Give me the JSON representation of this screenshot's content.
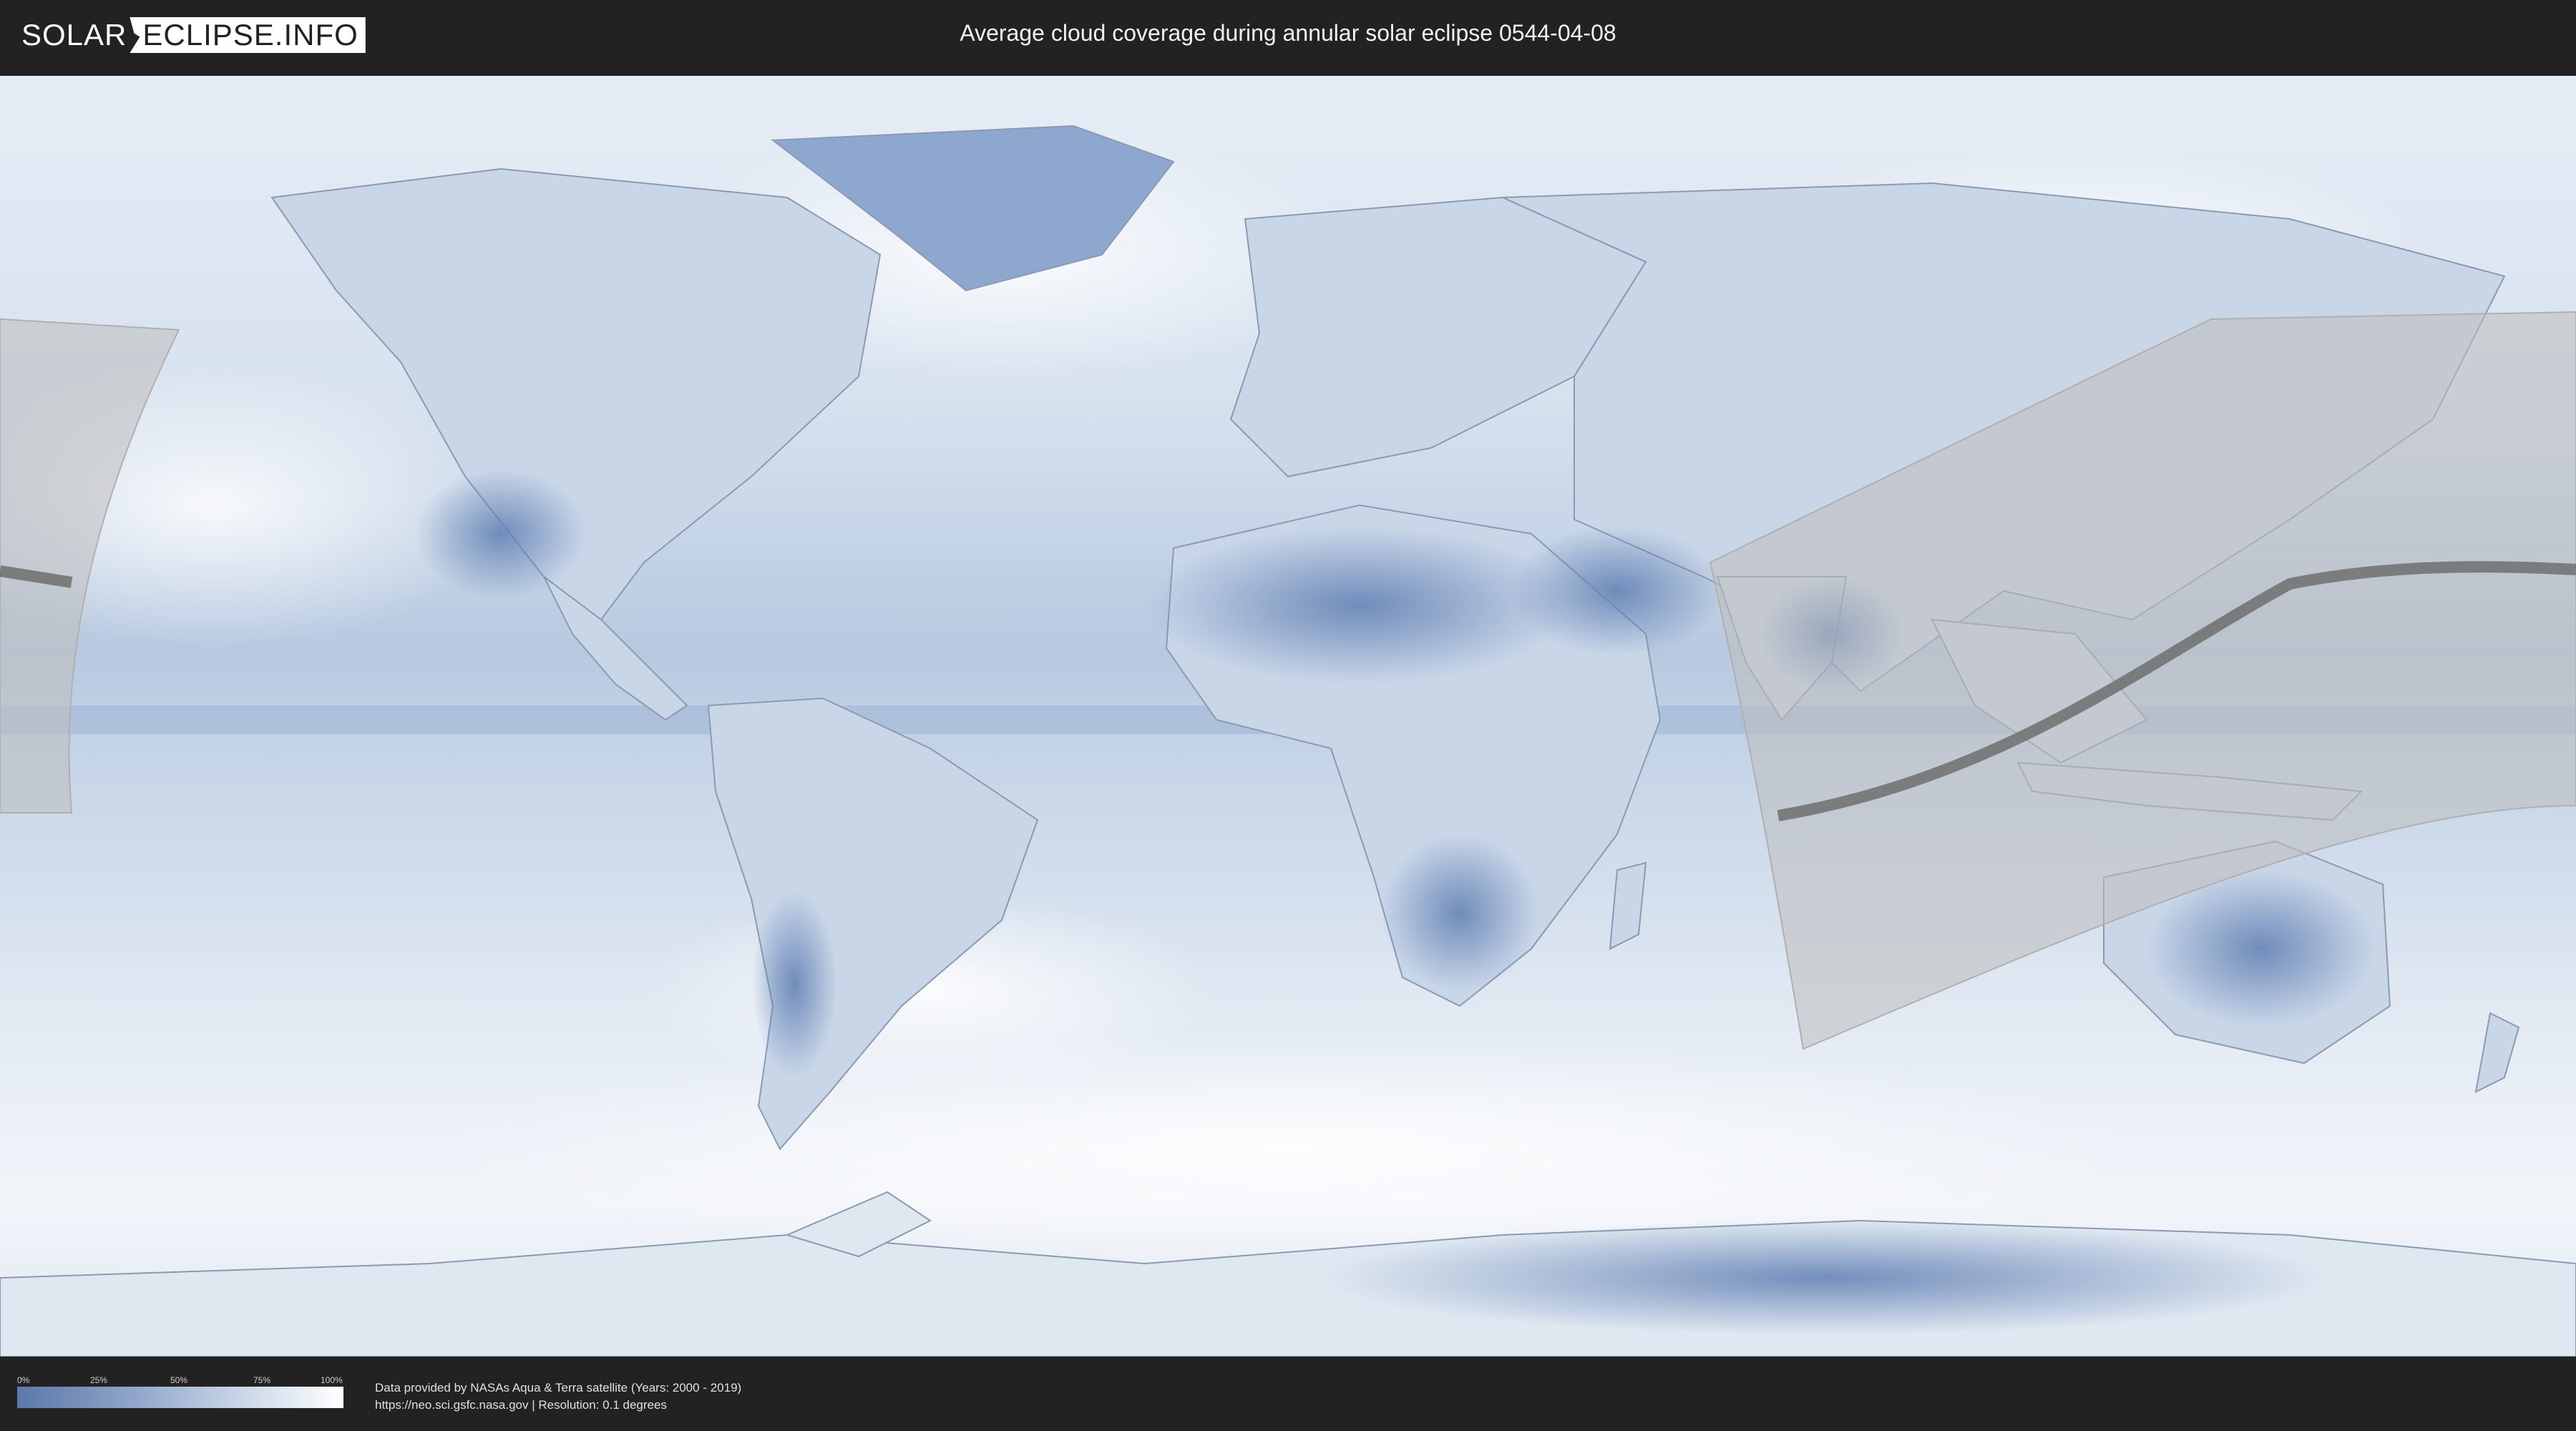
{
  "header": {
    "logo_part1": "SOLAR",
    "logo_part2": "ECLIPSE.INFO",
    "title": "Average cloud coverage during annular solar eclipse 0544-04-08"
  },
  "map": {
    "style": "cloud-coverage-world-map",
    "ocean_color": "#cdd9ea",
    "land_clear_color": "#6f8dbb",
    "cloudy_color": "#ffffff",
    "eclipse_overlay_color": "#bdbdbd",
    "central_line_color": "#7a7a7a"
  },
  "legend": {
    "ticks": [
      "0%",
      "25%",
      "50%",
      "75%",
      "100%"
    ],
    "gradient_low_color": "#5b78a8",
    "gradient_high_color": "#ffffff"
  },
  "credits": {
    "line1": "Data provided by NASAs Aqua & Terra satellite (Years: 2000 - 2019)",
    "line2": "https://neo.sci.gsfc.nasa.gov | Resolution: 0.1 degrees"
  }
}
